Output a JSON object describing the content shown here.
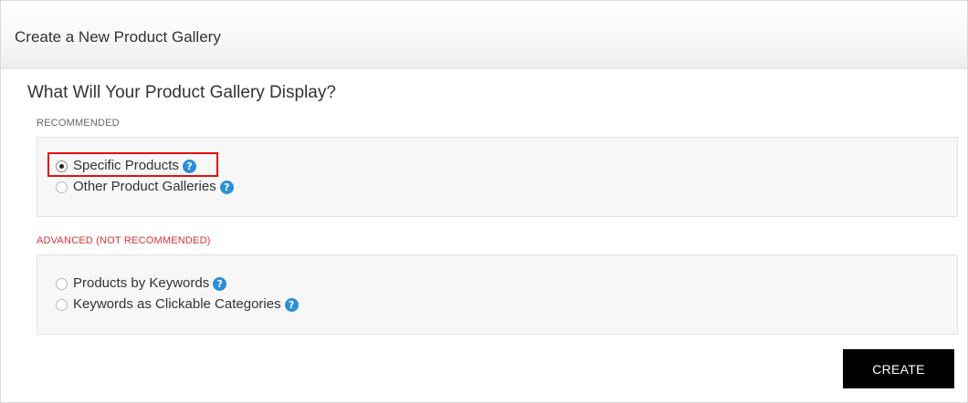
{
  "header": {
    "title": "Create a New Product Gallery"
  },
  "question": "What Will Your Product Gallery Display?",
  "sections": {
    "recommended": {
      "label": "RECOMMENDED",
      "options": [
        {
          "label": "Specific Products",
          "checked": true,
          "help_icon": "question-circle-icon"
        },
        {
          "label": "Other Product Galleries",
          "checked": false,
          "help_icon": "question-circle-icon"
        }
      ]
    },
    "advanced": {
      "label": "ADVANCED (NOT RECOMMENDED)",
      "options": [
        {
          "label": "Products by Keywords",
          "checked": false,
          "help_icon": "question-circle-icon"
        },
        {
          "label": "Keywords as Clickable Categories",
          "checked": false,
          "help_icon": "question-circle-icon"
        }
      ]
    }
  },
  "help_glyph": "?",
  "create_button": {
    "label": "CREATE"
  },
  "colors": {
    "advanced_label": "#d9303a",
    "help_icon": "#2b8fd8",
    "highlight_box": "#e01010",
    "button_bg": "#000000"
  }
}
